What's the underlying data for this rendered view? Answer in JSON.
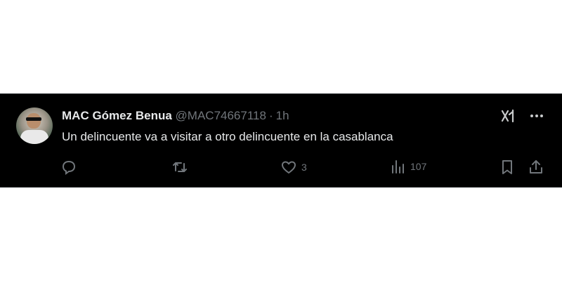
{
  "tweet": {
    "author_name": "MAC Gómez Benua",
    "author_handle": "@MAC74667118",
    "separator": "·",
    "time": "1h",
    "text": "Un delincuente va a visitar a otro delincuente en la casablanca",
    "likes": "3",
    "views": "107"
  },
  "icons": {
    "grok": "grok-icon",
    "more": "more-icon",
    "reply": "reply-icon",
    "retweet": "retweet-icon",
    "like": "heart-icon",
    "views": "bar-chart-icon",
    "bookmark": "bookmark-icon",
    "share": "share-icon"
  },
  "colors": {
    "background": "#000000",
    "primary_text": "#e7e9ea",
    "secondary_text": "#71767b"
  }
}
